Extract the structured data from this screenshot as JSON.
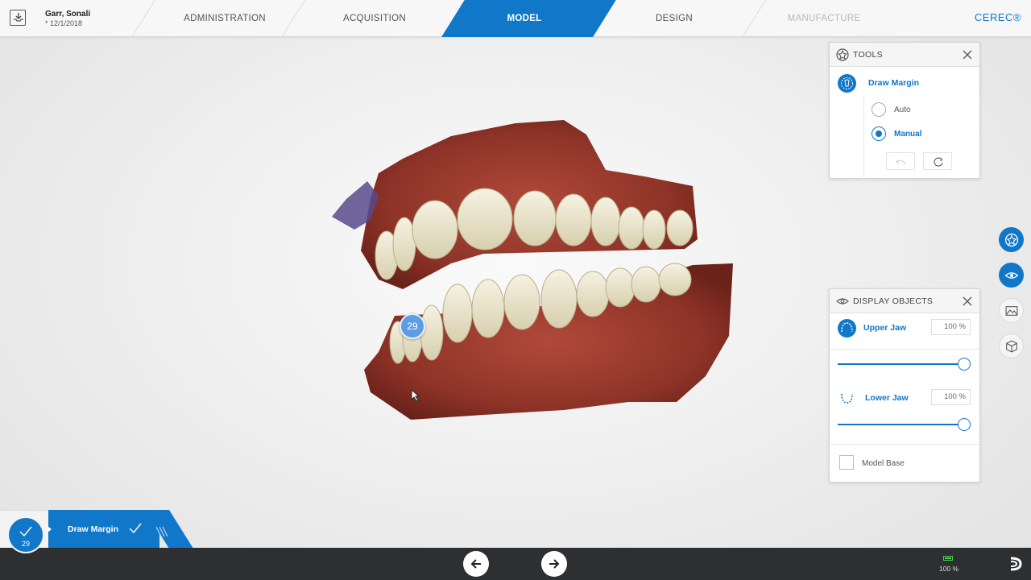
{
  "patient": {
    "name": "Garr, Sonali",
    "dob": "* 12/1/2018"
  },
  "phases": [
    {
      "label": "ADMINISTRATION",
      "state": "normal"
    },
    {
      "label": "ACQUISITION",
      "state": "normal"
    },
    {
      "label": "MODEL",
      "state": "active"
    },
    {
      "label": "DESIGN",
      "state": "normal"
    },
    {
      "label": "MANUFACTURE",
      "state": "disabled"
    }
  ],
  "brand": "CEREC®",
  "model": {
    "tooth_badge": "29"
  },
  "tools_panel": {
    "title": "TOOLS",
    "tool_label": "Draw Margin",
    "options": [
      {
        "label": "Auto",
        "checked": false
      },
      {
        "label": "Manual",
        "checked": true
      }
    ]
  },
  "display_panel": {
    "title": "DISPLAY OBJECTS",
    "upper_jaw": {
      "label": "Upper Jaw",
      "value": "100 %",
      "opacity": 1.0
    },
    "lower_jaw": {
      "label": "Lower Jaw",
      "value": "100 %",
      "opacity": 1.0
    },
    "model_base": {
      "label": "Model Base",
      "checked": false
    }
  },
  "step": {
    "number": "29",
    "label": "Draw Margin"
  },
  "status": {
    "battery": "100 %"
  },
  "colors": {
    "accent": "#1077c9",
    "battery": "#4bd04b",
    "bottom_bar": "#2d2f31"
  },
  "icons": {
    "patient": "download-box-icon",
    "tools": "tools-star-icon",
    "draw_margin": "tooth-margin-icon",
    "display": "eye-icon",
    "close": "close-icon",
    "undo": "undo-icon",
    "reset": "refresh-icon",
    "upper_jaw": "upper-jaw-icon",
    "lower_jaw": "lower-jaw-icon",
    "prev": "arrow-left-icon",
    "next": "arrow-right-icon"
  }
}
